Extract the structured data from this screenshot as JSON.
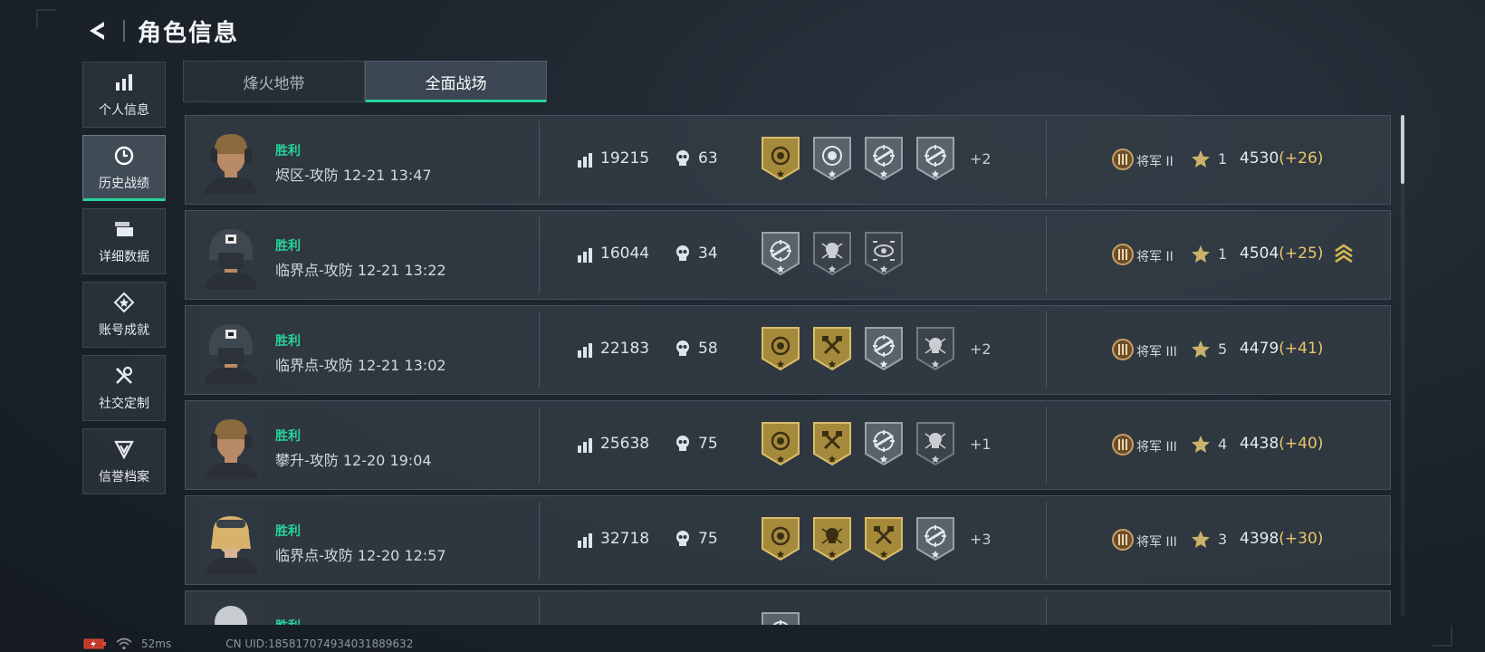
{
  "header": {
    "title": "角色信息"
  },
  "sidebar": {
    "items": [
      {
        "label": "个人信息",
        "icon": "bar-chart-icon",
        "active": false
      },
      {
        "label": "历史战绩",
        "icon": "clock-icon",
        "active": true
      },
      {
        "label": "详细数据",
        "icon": "cards-icon",
        "active": false
      },
      {
        "label": "账号成就",
        "icon": "achievement-icon",
        "active": false
      },
      {
        "label": "社交定制",
        "icon": "tools-icon",
        "active": false
      },
      {
        "label": "信誉档案",
        "icon": "shield-v-icon",
        "active": false
      }
    ]
  },
  "tabs": [
    {
      "label": "烽火地带",
      "active": false
    },
    {
      "label": "全面战场",
      "active": true
    }
  ],
  "matches": [
    {
      "result": "胜利",
      "info": "烬区-攻防 12-21 13:47",
      "score": "19215",
      "kills": "63",
      "medals": [
        "gold-wreath-medal-icon",
        "silver-target-medal-icon",
        "silver-rifle-medal-icon",
        "silver-rifle-medal-icon"
      ],
      "extra": "+2",
      "rank_name": "将军 II",
      "stars": "1",
      "points": "4530",
      "delta": "(+26)",
      "rank_up": false,
      "avatar": "soldier-blond-avatar"
    },
    {
      "result": "胜利",
      "info": "临界点-攻防 12-21 13:22",
      "score": "16044",
      "kills": "34",
      "medals": [
        "silver-rifle-medal-icon",
        "dark-skull-medal-icon",
        "dark-eye-medal-icon"
      ],
      "extra": "",
      "rank_name": "将军 II",
      "stars": "1",
      "points": "4504",
      "delta": "(+25)",
      "rank_up": true,
      "avatar": "soldier-helmet-avatar"
    },
    {
      "result": "胜利",
      "info": "临界点-攻防 12-21 13:02",
      "score": "22183",
      "kills": "58",
      "medals": [
        "gold-wreath-medal-icon",
        "gold-axes-medal-icon",
        "silver-rifle-medal-icon",
        "dark-skull-medal-icon"
      ],
      "extra": "+2",
      "rank_name": "将军 III",
      "stars": "5",
      "points": "4479",
      "delta": "(+41)",
      "rank_up": false,
      "avatar": "soldier-helmet-avatar"
    },
    {
      "result": "胜利",
      "info": "攀升-攻防 12-20 19:04",
      "score": "25638",
      "kills": "75",
      "medals": [
        "gold-wreath-medal-icon",
        "gold-axes-medal-icon",
        "silver-rifle-medal-icon",
        "dark-skull-medal-icon"
      ],
      "extra": "+1",
      "rank_name": "将军 III",
      "stars": "4",
      "points": "4438",
      "delta": "(+40)",
      "rank_up": false,
      "avatar": "soldier-blond-avatar"
    },
    {
      "result": "胜利",
      "info": "临界点-攻防 12-20 12:57",
      "score": "32718",
      "kills": "75",
      "medals": [
        "gold-wreath-medal-icon",
        "gold-skull-medal-icon",
        "gold-axes-medal-icon",
        "silver-rifle-medal-icon"
      ],
      "extra": "+3",
      "rank_name": "将军 III",
      "stars": "3",
      "points": "4398",
      "delta": "(+30)",
      "rank_up": false,
      "avatar": "soldier-goggles-avatar"
    },
    {
      "result": "胜利",
      "info": "",
      "score": "",
      "kills": "",
      "medals": [
        "silver-rifle-medal-icon"
      ],
      "extra": "",
      "rank_name": "",
      "stars": "",
      "points": "",
      "delta": "",
      "rank_up": false,
      "avatar": "soldier-grey-avatar"
    }
  ],
  "status": {
    "ping": "52ms",
    "uid": "CN UID:18581707493403188​9632"
  },
  "colors": {
    "accent": "#27d39a",
    "gold": "#c9a64a",
    "delta": "#e8c66a"
  }
}
